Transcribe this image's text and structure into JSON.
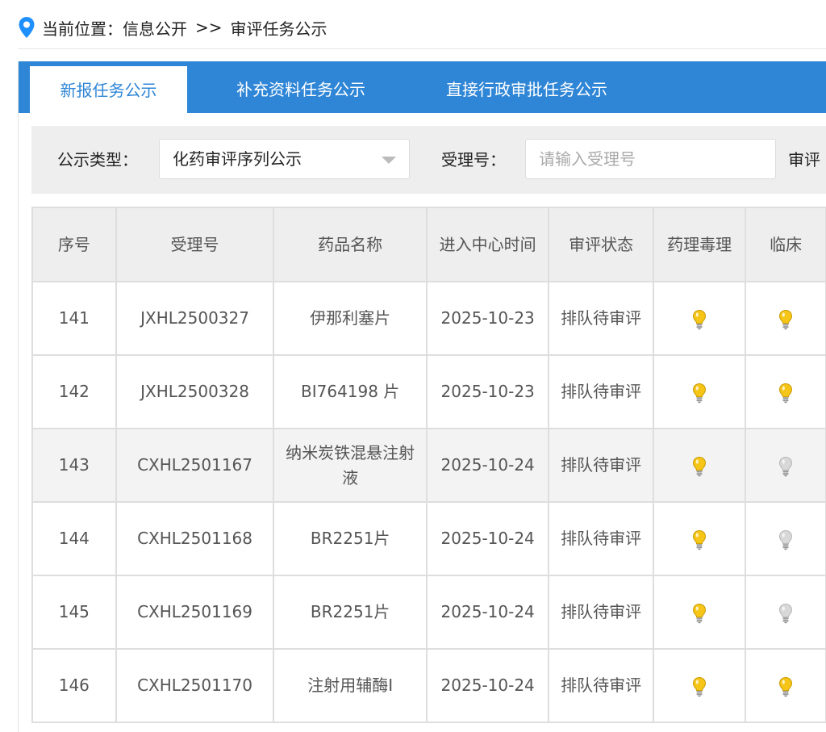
{
  "breadcrumb": {
    "label": "当前位置：信息公开",
    "separator": ">>",
    "current": "审评任务公示"
  },
  "tabs": [
    {
      "label": "新报任务公示",
      "active": true
    },
    {
      "label": "补充资料任务公示",
      "active": false
    },
    {
      "label": "直接行政审批任务公示",
      "active": false
    }
  ],
  "filters": {
    "type_label": "公示类型：",
    "type_value": "化药审评序列公示",
    "accept_label": "受理号：",
    "accept_placeholder": "请输入受理号",
    "review_label": "审评"
  },
  "table": {
    "headers": [
      "序号",
      "受理号",
      "药品名称",
      "进入中心时间",
      "审评状态",
      "药理毒理",
      "临床"
    ],
    "rows": [
      {
        "no": "141",
        "accept": "JXHL2500327",
        "name": "伊那利塞片",
        "date": "2025-10-23",
        "status": "排队待审评",
        "pharm": "on",
        "clinical": "on"
      },
      {
        "no": "142",
        "accept": "JXHL2500328",
        "name": "BI764198 片",
        "date": "2025-10-23",
        "status": "排队待审评",
        "pharm": "on",
        "clinical": "on"
      },
      {
        "no": "143",
        "accept": "CXHL2501167",
        "name": "纳米炭铁混悬注射液",
        "date": "2025-10-24",
        "status": "排队待审评",
        "pharm": "on",
        "clinical": "off"
      },
      {
        "no": "144",
        "accept": "CXHL2501168",
        "name": "BR2251片",
        "date": "2025-10-24",
        "status": "排队待审评",
        "pharm": "on",
        "clinical": "off"
      },
      {
        "no": "145",
        "accept": "CXHL2501169",
        "name": "BR2251片",
        "date": "2025-10-24",
        "status": "排队待审评",
        "pharm": "on",
        "clinical": "off"
      },
      {
        "no": "146",
        "accept": "CXHL2501170",
        "name": "注射用辅酶I",
        "date": "2025-10-24",
        "status": "排队待审评",
        "pharm": "on",
        "clinical": "on"
      }
    ]
  },
  "icons": {
    "location": "location-pin-icon",
    "dropdown": "chevron-down-icon",
    "status_on": "lightbulb-lit-icon",
    "status_off": "lightbulb-unlit-icon"
  },
  "colors": {
    "accent": "#2f86d6",
    "bulb_on": "#f5c518",
    "bulb_off": "#d8d8d8"
  }
}
